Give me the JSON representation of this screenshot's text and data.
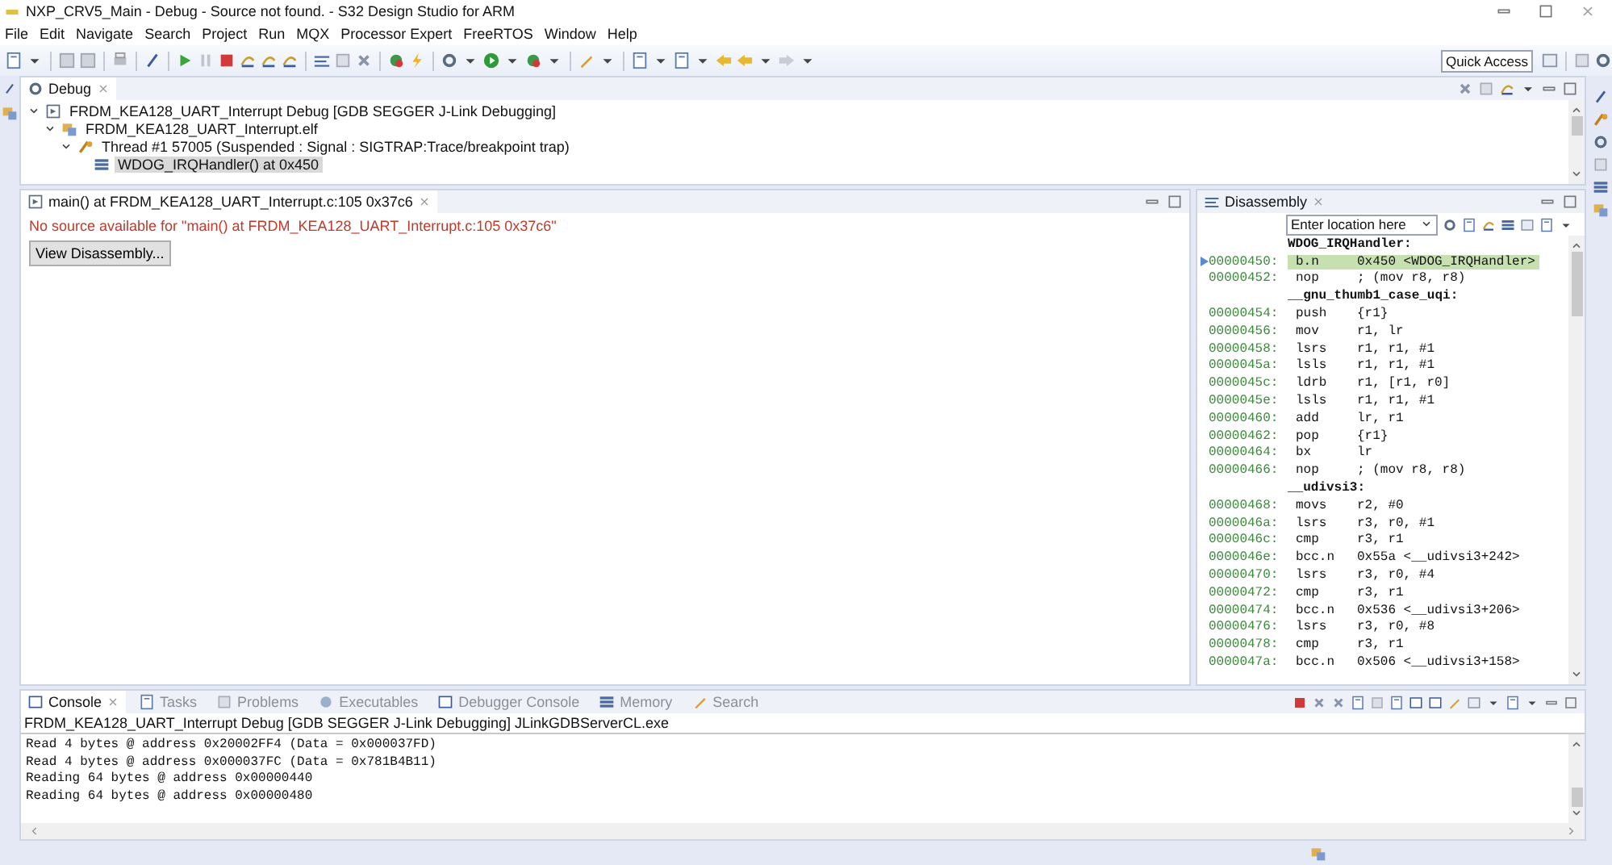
{
  "window": {
    "title": "NXP_CRV5_Main - Debug - Source not found. - S32 Design Studio for ARM"
  },
  "menu": [
    "File",
    "Edit",
    "Navigate",
    "Search",
    "Project",
    "Run",
    "MQX",
    "Processor Expert",
    "FreeRTOS",
    "Window",
    "Help"
  ],
  "toolbar": {
    "quick_access": "Quick Access"
  },
  "debug_view": {
    "tab": {
      "label": "Debug",
      "selected": true
    },
    "tree": [
      {
        "label": "FRDM_KEA128_UART_Interrupt Debug [GDB SEGGER J-Link Debugging]",
        "kind": "launch",
        "expanded": true,
        "selected": false,
        "children": [
          {
            "label": "FRDM_KEA128_UART_Interrupt.elf",
            "kind": "process",
            "expanded": true,
            "selected": false,
            "children": [
              {
                "label": "Thread #1 57005 (Suspended : Signal : SIGTRAP:Trace/breakpoint trap)",
                "kind": "thread",
                "expanded": true,
                "selected": false,
                "children": [
                  {
                    "label": "WDOG_IRQHandler() at 0x450",
                    "kind": "frame",
                    "selected": true
                  }
                ]
              }
            ]
          }
        ]
      }
    ]
  },
  "editor": {
    "tab": {
      "label": "main() at FRDM_KEA128_UART_Interrupt.c:105 0x37c6",
      "selected": true
    },
    "message": "No source available for \"main() at FRDM_KEA128_UART_Interrupt.c:105 0x37c6\"",
    "button": "View Disassembly..."
  },
  "disassembly": {
    "tab": {
      "label": "Disassembly",
      "selected": false
    },
    "location": "Enter location here",
    "rows": [
      {
        "kind": "label",
        "text": "WDOG_IRQHandler:"
      },
      {
        "kind": "instr",
        "address": "00000450:",
        "mnemonic": "b.n",
        "operands": "0x450 <WDOG_IRQHandler>",
        "current": true
      },
      {
        "kind": "instr",
        "address": "00000452:",
        "mnemonic": "nop",
        "operands": "; (mov r8, r8)",
        "current": false
      },
      {
        "kind": "label",
        "text": "__gnu_thumb1_case_uqi:"
      },
      {
        "kind": "instr",
        "address": "00000454:",
        "mnemonic": "push",
        "operands": "{r1}",
        "current": false
      },
      {
        "kind": "instr",
        "address": "00000456:",
        "mnemonic": "mov",
        "operands": "r1, lr",
        "current": false
      },
      {
        "kind": "instr",
        "address": "00000458:",
        "mnemonic": "lsrs",
        "operands": "r1, r1, #1",
        "current": false
      },
      {
        "kind": "instr",
        "address": "0000045a:",
        "mnemonic": "lsls",
        "operands": "r1, r1, #1",
        "current": false
      },
      {
        "kind": "instr",
        "address": "0000045c:",
        "mnemonic": "ldrb",
        "operands": "r1, [r1, r0]",
        "current": false
      },
      {
        "kind": "instr",
        "address": "0000045e:",
        "mnemonic": "lsls",
        "operands": "r1, r1, #1",
        "current": false
      },
      {
        "kind": "instr",
        "address": "00000460:",
        "mnemonic": "add",
        "operands": "lr, r1",
        "current": false
      },
      {
        "kind": "instr",
        "address": "00000462:",
        "mnemonic": "pop",
        "operands": "{r1}",
        "current": false
      },
      {
        "kind": "instr",
        "address": "00000464:",
        "mnemonic": "bx",
        "operands": "lr",
        "current": false
      },
      {
        "kind": "instr",
        "address": "00000466:",
        "mnemonic": "nop",
        "operands": "; (mov r8, r8)",
        "current": false
      },
      {
        "kind": "label",
        "text": "__udivsi3:"
      },
      {
        "kind": "instr",
        "address": "00000468:",
        "mnemonic": "movs",
        "operands": "r2, #0",
        "current": false
      },
      {
        "kind": "instr",
        "address": "0000046a:",
        "mnemonic": "lsrs",
        "operands": "r3, r0, #1",
        "current": false
      },
      {
        "kind": "instr",
        "address": "0000046c:",
        "mnemonic": "cmp",
        "operands": "r3, r1",
        "current": false
      },
      {
        "kind": "instr",
        "address": "0000046e:",
        "mnemonic": "bcc.n",
        "operands": "0x55a <__udivsi3+242>",
        "current": false
      },
      {
        "kind": "instr",
        "address": "00000470:",
        "mnemonic": "lsrs",
        "operands": "r3, r0, #4",
        "current": false
      },
      {
        "kind": "instr",
        "address": "00000472:",
        "mnemonic": "cmp",
        "operands": "r3, r1",
        "current": false
      },
      {
        "kind": "instr",
        "address": "00000474:",
        "mnemonic": "bcc.n",
        "operands": "0x536 <__udivsi3+206>",
        "current": false
      },
      {
        "kind": "instr",
        "address": "00000476:",
        "mnemonic": "lsrs",
        "operands": "r3, r0, #8",
        "current": false
      },
      {
        "kind": "instr",
        "address": "00000478:",
        "mnemonic": "cmp",
        "operands": "r3, r1",
        "current": false
      },
      {
        "kind": "instr",
        "address": "0000047a:",
        "mnemonic": "bcc.n",
        "operands": "0x506 <__udivsi3+158>",
        "current": false
      }
    ]
  },
  "console": {
    "tabs": [
      {
        "label": "Console",
        "selected": true
      },
      {
        "label": "Tasks",
        "selected": false
      },
      {
        "label": "Problems",
        "selected": false
      },
      {
        "label": "Executables",
        "selected": false
      },
      {
        "label": "Debugger Console",
        "selected": false
      },
      {
        "label": "Memory",
        "selected": false
      },
      {
        "label": "Search",
        "selected": false
      }
    ],
    "process": "FRDM_KEA128_UART_Interrupt Debug [GDB SEGGER J-Link Debugging] JLinkGDBServerCL.exe",
    "lines": [
      "Read 4 bytes @ address 0x20002FF4 (Data = 0x000037FD)",
      "Read 4 bytes @ address 0x000037FC (Data = 0x781B4B11)",
      "Reading 64 bytes @ address 0x00000440",
      "Reading 64 bytes @ address 0x00000480"
    ]
  }
}
